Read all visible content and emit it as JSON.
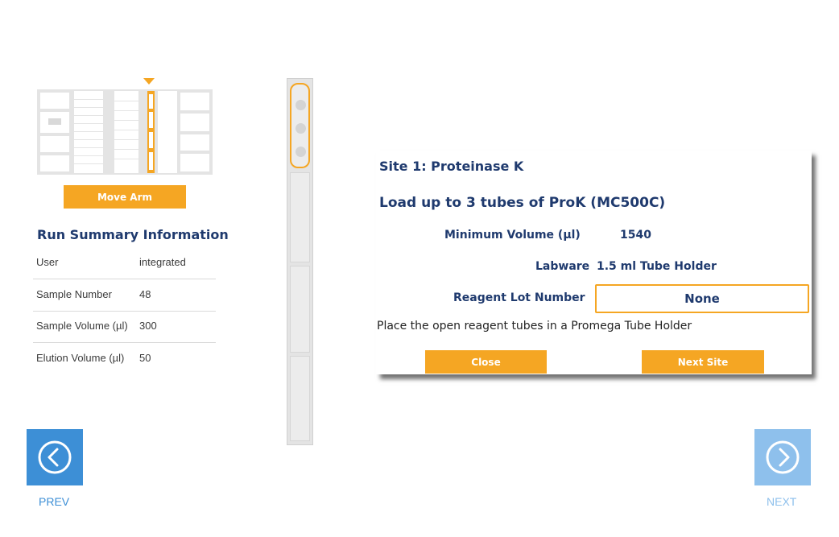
{
  "deck": {
    "move_arm_label": "Move Arm"
  },
  "summary": {
    "title": "Run Summary Information",
    "rows": [
      {
        "label": "User",
        "value": "integrated"
      },
      {
        "label": "Sample Number",
        "value": "48"
      },
      {
        "label": "Sample Volume (µl)",
        "value": "300"
      },
      {
        "label": "Elution Volume (µl)",
        "value": "50"
      }
    ]
  },
  "dialog": {
    "title": "Site 1: Proteinase K",
    "load_text": "Load up to 3 tubes of ProK (MC500C)",
    "min_volume_label": "Minimum Volume (µl)",
    "min_volume_value": "1540",
    "labware_label": "Labware",
    "labware_value": "1.5 ml Tube Holder",
    "lot_label": "Reagent Lot Number",
    "lot_value": "None",
    "instruction": "Place the open reagent tubes in a Promega Tube Holder",
    "close_label": "Close",
    "next_site_label": "Next Site"
  },
  "nav": {
    "prev_label": "PREV",
    "next_label": "NEXT"
  },
  "colors": {
    "accent": "#f5a623",
    "title": "#1f3a6e",
    "prev_blue": "#3d8fd6",
    "next_blue_disabled": "#8ec0ec"
  }
}
